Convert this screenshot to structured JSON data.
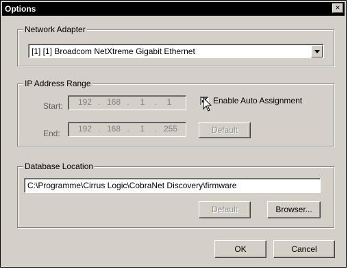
{
  "window": {
    "title": "Options",
    "close_glyph": "×"
  },
  "network_adapter": {
    "legend": "Network Adapter",
    "selected": "[1] [1] Broadcom NetXtreme Gigabit Ethernet"
  },
  "ip_range": {
    "legend": "IP Address Range",
    "start_label": "Start:",
    "end_label": "End:",
    "start": [
      "192",
      "168",
      "1",
      "1"
    ],
    "end": [
      "192",
      "168",
      "1",
      "255"
    ],
    "dot": ".",
    "auto_assign_label": "Enable Auto Assignment",
    "auto_assign_checked": "✔",
    "default_label": "Default"
  },
  "database": {
    "legend": "Database Location",
    "path": "C:\\Programme\\Cirrus Logic\\CobraNet Discovery\\firmware",
    "default_label": "Default",
    "browse_label": "Browser..."
  },
  "footer": {
    "ok_label": "OK",
    "cancel_label": "Cancel"
  },
  "icons": {
    "cursor": "arrow-cursor-icon",
    "dropdown": "chevron-down-icon"
  }
}
